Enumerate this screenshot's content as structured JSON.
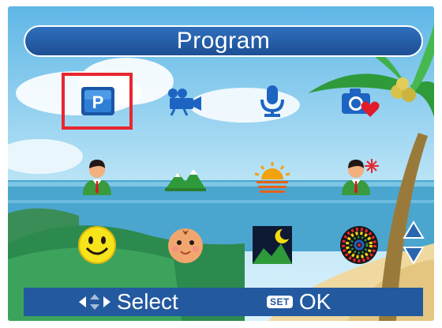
{
  "header": {
    "title": "Program"
  },
  "modes": [
    {
      "icon": "program-p-icon",
      "label": "P",
      "selected": true
    },
    {
      "icon": "video-camera-icon",
      "selected": false
    },
    {
      "icon": "microphone-icon",
      "selected": false
    },
    {
      "icon": "camera-heart-icon",
      "selected": false
    },
    {
      "icon": "portrait-icon",
      "selected": false
    },
    {
      "icon": "landscape-icon",
      "selected": false
    },
    {
      "icon": "sunset-icon",
      "selected": false
    },
    {
      "icon": "night-portrait-icon",
      "selected": false
    },
    {
      "icon": "smile-face-icon",
      "selected": false
    },
    {
      "icon": "baby-face-icon",
      "selected": false
    },
    {
      "icon": "night-scene-icon",
      "selected": false
    },
    {
      "icon": "fireworks-icon",
      "selected": false
    }
  ],
  "scroll": {
    "up_icon": "arrow-up-icon",
    "down_icon": "arrow-down-icon"
  },
  "footer": {
    "select_icon": "left-right-arrows-icon",
    "select_label": "Select",
    "set_badge": "SET",
    "ok_label": "OK"
  },
  "colors": {
    "accent": "#23599f",
    "selection": "#e8262f",
    "title_bar": "#2a66b0"
  }
}
